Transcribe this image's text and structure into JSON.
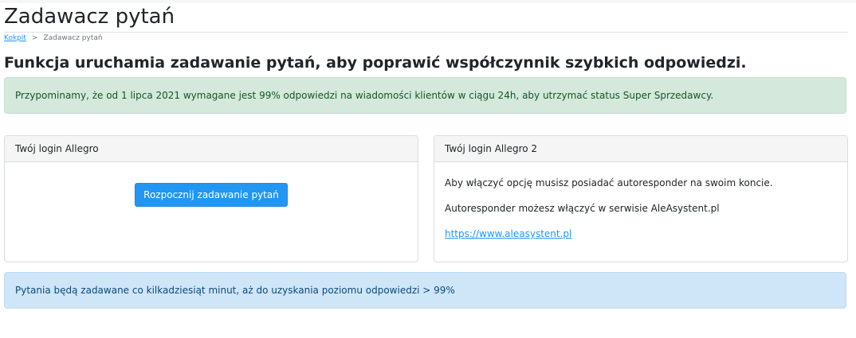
{
  "page": {
    "title": "Zadawacz pytań",
    "breadcrumb": {
      "home": "Kokpit",
      "separator": ">",
      "current": "Zadawacz pytań"
    },
    "headline": "Funkcja uruchamia zadawanie pytań, aby poprawić współczynnik szybkich odpowiedzi."
  },
  "alerts": {
    "reminder": "Przypominamy, że od 1 lipca 2021 wymagane jest 99% odpowiedzi na wiadomości klientów w ciągu 24h, aby utrzymać status Super Sprzedawcy.",
    "info": "Pytania będą zadawane co kilkadziesiąt minut, aż do uzyskania poziomu odpowiedzi > 99%"
  },
  "cards": {
    "left": {
      "header": "Twój login Allegro",
      "button_label": "Rozpocznij zadawanie pytań"
    },
    "right": {
      "header": "Twój login Allegro 2",
      "line1": "Aby włączyć opcję musisz posiadać autoresponder na swoim koncie.",
      "line2": "Autoresponder możesz włączyć w serwisie AleAsystent.pl",
      "link": "https://www.aleasystent.pl"
    }
  },
  "colors": {
    "primary": "#2196f3",
    "success_bg": "#d4e8dc",
    "success_text": "#155724",
    "info_bg": "#cfe5f8",
    "info_text": "#0c4a7a"
  }
}
